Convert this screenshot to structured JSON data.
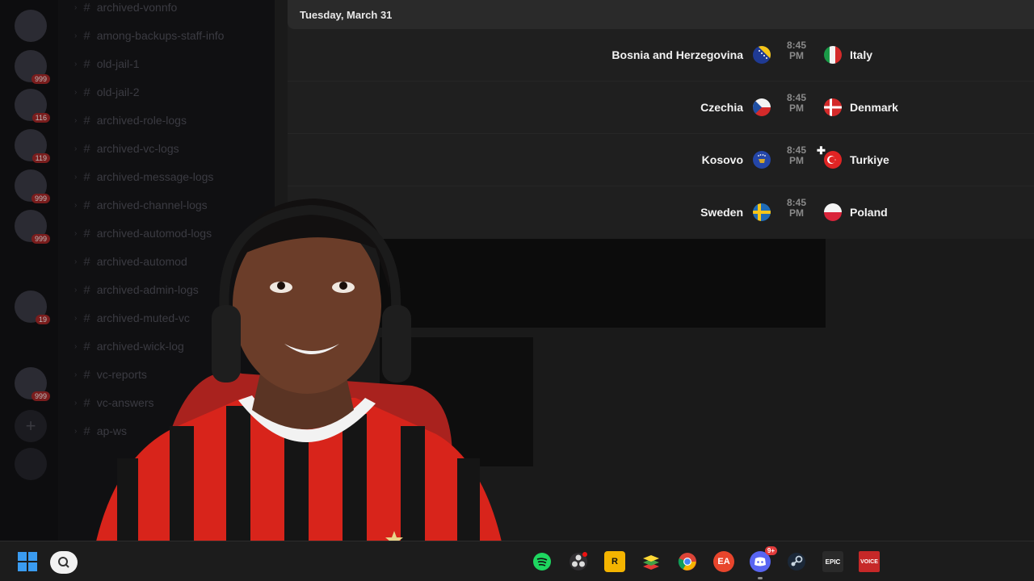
{
  "schedule": {
    "date": "Tuesday, March 31",
    "matches": [
      {
        "home": "Bosnia and Herzegovina",
        "home_flag": "bosnia-flag-icon",
        "time_hm": "8:45",
        "time_ampm": "PM",
        "away": "Italy",
        "away_flag": "italy-flag-icon"
      },
      {
        "home": "Czechia",
        "home_flag": "czechia-flag-icon",
        "time_hm": "8:45",
        "time_ampm": "PM",
        "away": "Denmark",
        "away_flag": "denmark-flag-icon"
      },
      {
        "home": "Kosovo",
        "home_flag": "kosovo-flag-icon",
        "time_hm": "8:45",
        "time_ampm": "PM",
        "away": "Turkiye",
        "away_flag": "turkey-flag-icon"
      },
      {
        "home": "Sweden",
        "home_flag": "sweden-flag-icon",
        "time_hm": "8:45",
        "time_ampm": "PM",
        "away": "Poland",
        "away_flag": "poland-flag-icon"
      }
    ]
  },
  "sidebar": {
    "channels": [
      "archived-vonnfo",
      "among-backups-staff-info",
      "old-jail-1",
      "old-jail-2",
      "archived-role-logs",
      "archived-vc-logs",
      "archived-message-logs",
      "archived-channel-logs",
      "archived-automod-logs",
      "archived-automod",
      "archived-admin-logs",
      "archived-muted-vc",
      "archived-wick-log",
      "vc-reports",
      "vc-answers",
      "ap-ws"
    ],
    "badges": [
      "999",
      "116",
      "119",
      "999",
      "999",
      "19",
      "999"
    ]
  },
  "taskbar": {
    "icons": [
      "windows-start-icon",
      "search-icon",
      "spotify-icon",
      "obs-icon",
      "rockstar-icon",
      "bluestacks-icon",
      "chrome-icon",
      "ea-icon",
      "discord-icon",
      "steam-icon",
      "epic-games-icon",
      "voicemeeter-icon"
    ],
    "discord_badge": "9+",
    "rockstar_label": "R",
    "ea_label": "EA",
    "epic_label": "EPIC",
    "voicemeeter_label": "VOICE"
  },
  "colors": {
    "panel": "#1f1f1f",
    "header": "#2a2a2a",
    "jersey_red": "#d8241b",
    "jersey_black": "#151515"
  }
}
